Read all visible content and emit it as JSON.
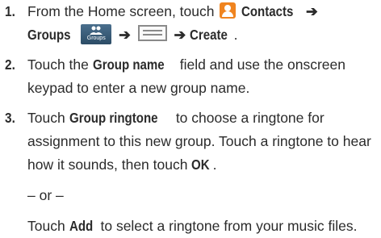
{
  "steps": [
    {
      "number": "1.",
      "lines": [
        {
          "pre": "From the Home screen, touch",
          "icon1_name": "contacts-app-icon",
          "bold1": "Contacts",
          "arrow": "➔"
        },
        {
          "bold1": "Groups",
          "icon_label": "Groups",
          "arrow1": "➔",
          "arrow2": "➔",
          "bold2": "Create",
          "tail": "."
        }
      ]
    },
    {
      "number": "2.",
      "line1_pre": "Touch the",
      "line1_bold": "Group name",
      "line1_post": "field and use the onscreen",
      "line2": "keypad to enter a new group name."
    },
    {
      "number": "3.",
      "line1_pre": "Touch",
      "line1_bold": "Group ringtone",
      "line1_post": "to choose a ringtone for",
      "line2": "assignment to this new group. Touch a ringtone to hear",
      "line3_pre": "how it sounds, then touch",
      "line3_bold": "OK",
      "line3_post": ".",
      "or_text": "– or –",
      "line5_pre": "Touch",
      "line5_bold": "Add",
      "line5_post": "to select a ringtone from your music files."
    }
  ]
}
